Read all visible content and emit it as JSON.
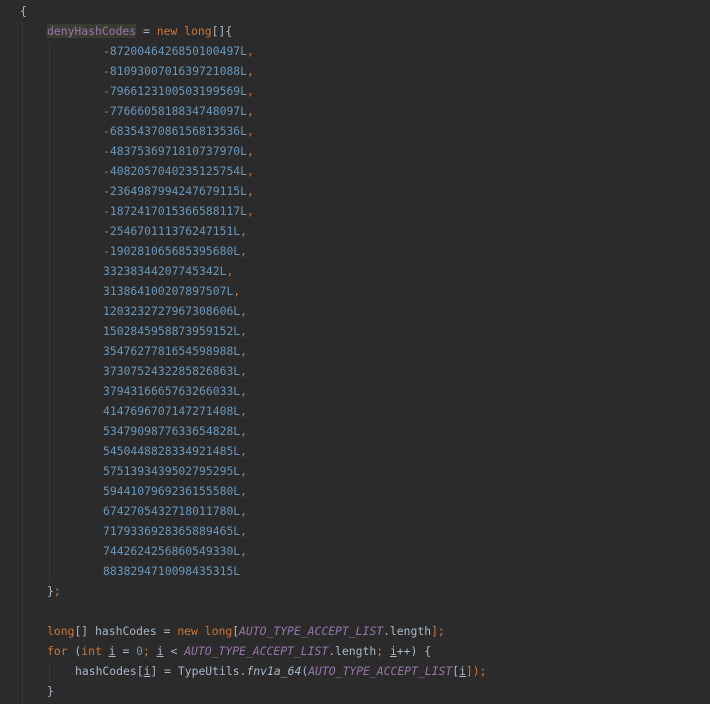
{
  "code": {
    "open_brace": "{",
    "field_name": "denyHashCodes",
    "assign": " = ",
    "kw_new": "new",
    "kw_long": "long",
    "array_open": "[]{",
    "numbers": [
      "-8720046426850100497L",
      "-8109300701639721088L",
      "-7966123100503199569L",
      "-7766605818834748097L",
      "-6835437086156813536L",
      "-4837536971810737970L",
      "-4082057040235125754L",
      "-2364987994247679115L",
      "-1872417015366588117L",
      "-254670111376247151L",
      "-190281065685395680L",
      "33238344207745342L",
      "313864100207897507L",
      "1203232727967308606L",
      "1502845958873959152L",
      "3547627781654598988L",
      "3730752432285826863L",
      "3794316665763266033L",
      "4147696707147271408L",
      "5347909877633654828L",
      "5450448828334921485L",
      "5751393439502795295L",
      "5944107969236155580L",
      "6742705432718011780L",
      "7179336928365889465L",
      "7442624256860549330L",
      "8838294710098435315L"
    ],
    "comma": ",",
    "array_close": "}",
    "semicolon": ";",
    "line2_type_end": "[] hashCodes = ",
    "line2_bracket_open": "[",
    "const_name": "AUTO_TYPE_ACCEPT_LIST",
    "line2_length": ".length",
    "line2_end": "];",
    "for_kw": "for",
    "for_paren": " (",
    "int_kw": "int",
    "var_i": "i",
    "for_init_rest": " = ",
    "zero": "0",
    "for_sep": "; ",
    "for_lt": " < ",
    "for_length": ".length",
    "for_inc": "++) {",
    "body_start": "hashCodes[",
    "body_mid": "] = TypeUtils.",
    "method_name": "fnv1a_64",
    "paren_open": "(",
    "body_bracket": "[",
    "body_end": "]);",
    "close_brace": "}"
  }
}
